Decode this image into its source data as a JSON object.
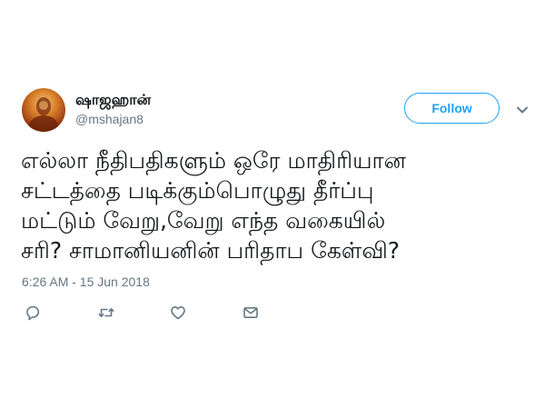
{
  "tweet": {
    "display_name": "ஷாஜஹான்",
    "handle": "@mshajan8",
    "follow_label": "Follow",
    "text_lines": [
      "எல்லா நீதிபதிகளும் ஒரே மாதிரியான",
      "சட்டத்தை படிக்கும்பொழுது தீர்ப்பு",
      "மட்டும் வேறு,வேறு எந்த வகையில்",
      "சரி? சாமானியனின் பரிதாப கேள்வி?"
    ],
    "timestamp": "6:26 AM - 15 Jun 2018"
  },
  "icons": {
    "reply": "reply-icon",
    "retweet": "retweet-icon",
    "like": "heart-icon",
    "message": "envelope-icon",
    "more": "chevron-down-icon"
  },
  "colors": {
    "accent": "#1da1f2",
    "text": "#14171a",
    "secondary": "#657786"
  }
}
